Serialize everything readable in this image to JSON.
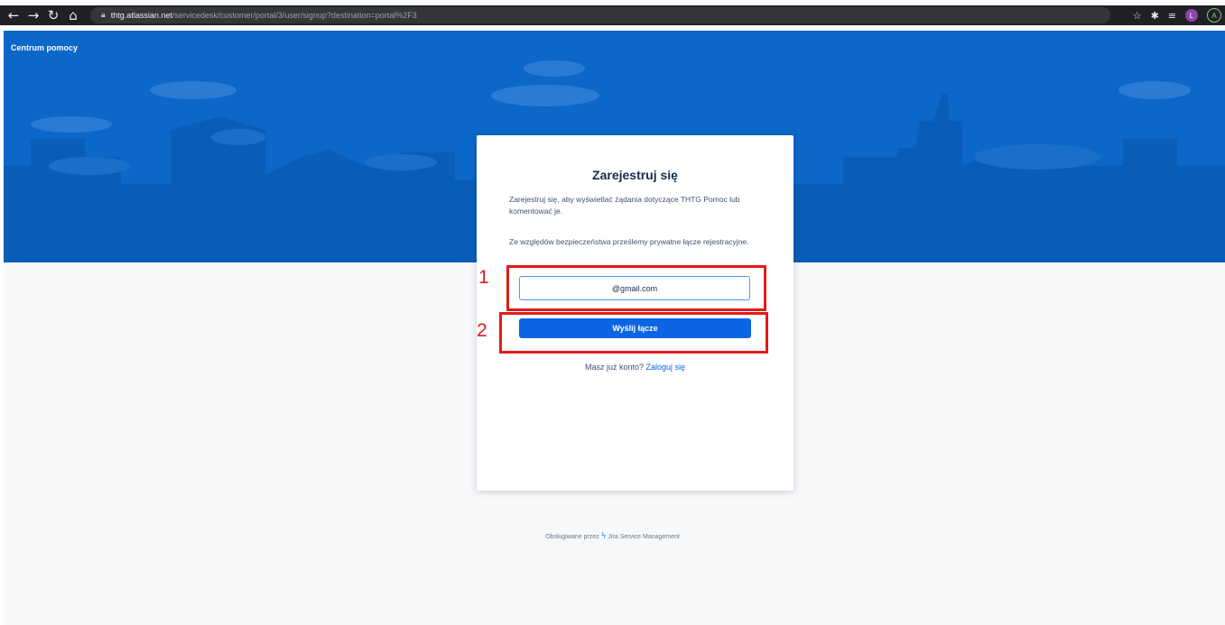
{
  "browser": {
    "url_host": "thtg.atlassian.net",
    "url_path": "/servicedesk/customer/portal/3/user/signup?destination=portal%2F3",
    "profile_initial": "L",
    "profile2_initial": "A"
  },
  "header": {
    "help_center": "Centrum pomocy"
  },
  "signup": {
    "title": "Zarejestruj się",
    "description": "Zarejestruj się, aby wyświetlać żądania dotyczące THTG Pomoc lub komentować je.",
    "security_note": "Ze względów bezpieczeństwa prześlemy prywatne łącze rejestracyjne.",
    "email_value": "@gmail.com",
    "submit_label": "Wyślij łącze",
    "login_prompt": "Masz już konto?",
    "login_link": "Zaloguj się"
  },
  "annotations": {
    "step1": "1",
    "step2": "2"
  },
  "footer": {
    "powered_by": "Obsługiwane przez",
    "product": "Jira Service Management"
  },
  "colors": {
    "hero_blue": "#0b67c8",
    "primary_button": "#0c66e4",
    "annotation_red": "#e21b1b"
  }
}
